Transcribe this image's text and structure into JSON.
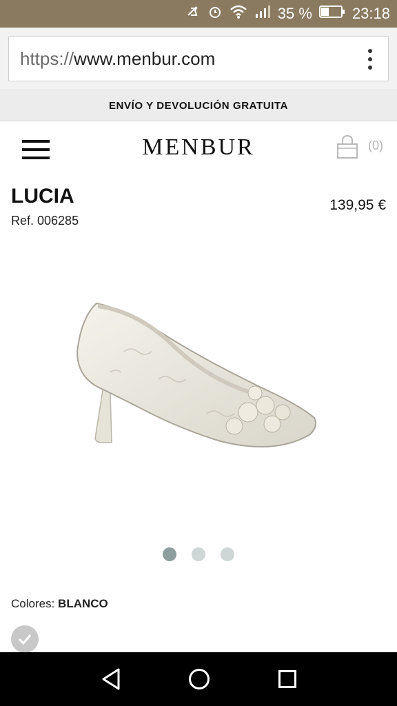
{
  "status_bar": {
    "battery_percent": "35 %",
    "time": "23:18",
    "icons": [
      "mute-icon",
      "alarm-icon",
      "wifi-icon",
      "signal-icon",
      "battery-icon"
    ]
  },
  "browser": {
    "url_scheme": "https://",
    "url_host": "www.menbur.com",
    "menu_icon": "overflow-menu-icon"
  },
  "promo_banner": "ENVÍO Y DEVOLUCIÓN GRATUITA",
  "header": {
    "logo": "MENBUR",
    "cart_count": "(0)",
    "menu_icon": "hamburger-icon",
    "cart_icon": "shopping-bag-icon"
  },
  "product": {
    "name": "LUCIA",
    "ref": "Ref. 006285",
    "price": "139,95 €",
    "colors_label": "Colores:",
    "color_value": "BLANCO",
    "gallery": {
      "count": 3,
      "active_index": 0
    }
  },
  "colors": {
    "status_bar_bg": "#8a7a60",
    "dot_active": "#8e9e9e",
    "dot_inactive": "#cfd6d6"
  },
  "nav_bar": {
    "icons": [
      "back-icon",
      "home-icon",
      "recents-icon"
    ]
  }
}
